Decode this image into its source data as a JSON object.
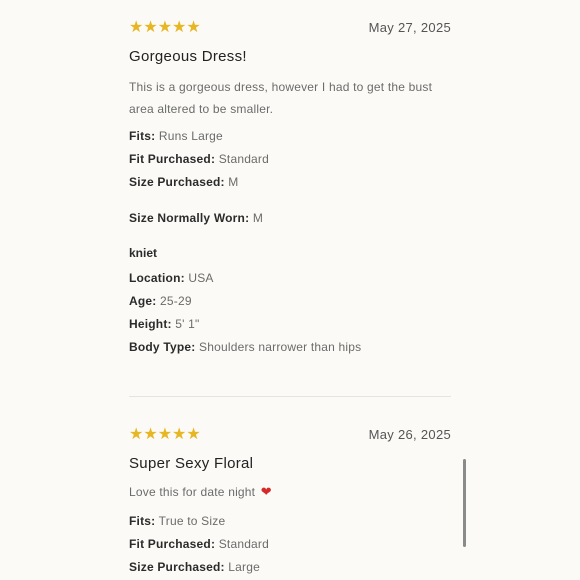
{
  "star_color": "#e7b623",
  "reviews": [
    {
      "stars": "★★★★★",
      "date": "May 27, 2025",
      "title": "Gorgeous Dress!",
      "text": "This is a gorgeous dress, however I had to get the bust area altered to be smaller.",
      "fits_label": "Fits:",
      "fits_value": "Runs Large",
      "fit_purchased_label": "Fit Purchased:",
      "fit_purchased_value": "Standard",
      "size_purchased_label": "Size Purchased:",
      "size_purchased_value": "M",
      "size_normally_label": "Size Normally Worn:",
      "size_normally_value": "M",
      "username": "kniet",
      "location_label": "Location:",
      "location_value": "USA",
      "age_label": "Age:",
      "age_value": "25-29",
      "height_label": "Height:",
      "height_value": "5' 1\"",
      "body_type_label": "Body Type:",
      "body_type_value": "Shoulders narrower than hips"
    },
    {
      "stars": "★★★★★",
      "date": "May 26, 2025",
      "title": "Super Sexy Floral",
      "text": "Love this for date night",
      "heart": "❤",
      "fits_label": "Fits:",
      "fits_value": "True to Size",
      "fit_purchased_label": "Fit Purchased:",
      "fit_purchased_value": "Standard",
      "size_purchased_label": "Size Purchased:",
      "size_purchased_value": "Large"
    }
  ]
}
